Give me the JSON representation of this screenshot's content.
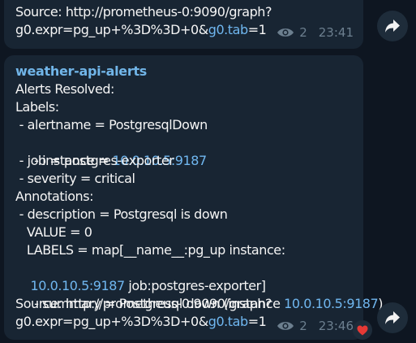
{
  "msg1": {
    "lines": [
      "Source: http://prometheus-0:9090/graph?"
    ],
    "last_prefix": "g0.expr=pg_up+%3D%3D+0&",
    "last_link": "g0.tab",
    "last_suffix": "=1",
    "views": "2",
    "time": "23:41"
  },
  "msg2": {
    "sender": "weather-api-alerts",
    "line1": "Alerts Resolved:",
    "line2": "Labels:",
    "line3": " - alertname = PostgresqlDown",
    "line4_prefix": " - instance = ",
    "line4_link": "10.0.10.5:9187",
    "line5": " - job = postgres-exporter",
    "line6": " - severity = critical",
    "line7": "Annotations:",
    "line8": " - description = Postgresql is down",
    "line9": "   VALUE = 0",
    "line10": "   LABELS = map[__name__:pg_up instance:",
    "line11_link": "10.0.10.5:9187",
    "line11_suffix": " job:postgres-exporter]",
    "line12_prefix": " - summary = Postgresql down (instance ",
    "line12_link": "10.0.10.5:9187",
    "line12_suffix": ")",
    "line13": "Source: http://prometheus-0:9090/graph?",
    "last_prefix": "g0.expr=pg_up+%3D%3D+0&",
    "last_link": "g0.tab",
    "last_suffix": "=1",
    "views": "2",
    "time": "23:46"
  },
  "icons": {
    "views": "eye-icon",
    "forward": "forward-arrow-icon",
    "reaction": "heart-icon"
  },
  "colors": {
    "background": "#0e1621",
    "bubble": "#182533",
    "link": "#70b7f0",
    "meta": "#6c7f8f",
    "heart": "#e53935"
  }
}
